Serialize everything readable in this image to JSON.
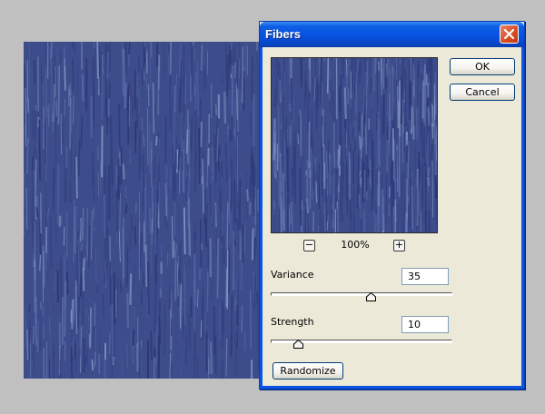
{
  "dialog": {
    "title": "Fibers",
    "ok_label": "OK",
    "cancel_label": "Cancel",
    "randomize_label": "Randomize"
  },
  "preview": {
    "zoom_level": "100%",
    "zoom_out_glyph": "−",
    "zoom_in_glyph": "+"
  },
  "variance": {
    "label": "Variance",
    "value": "35",
    "slider_fraction": 0.55
  },
  "strength": {
    "label": "Strength",
    "value": "10",
    "slider_fraction": 0.15
  },
  "colors": {
    "fiber_dark": "#2c3573",
    "fiber_mid": "#3d4c8a",
    "fiber_light": "#7f95c2",
    "titlebar": "#0652e0",
    "dialog_face": "#ece9d8",
    "close_button": "#d6491f"
  },
  "icons": {
    "close": "close-x-icon",
    "zoom_out": "minus-icon",
    "zoom_in": "plus-icon"
  }
}
